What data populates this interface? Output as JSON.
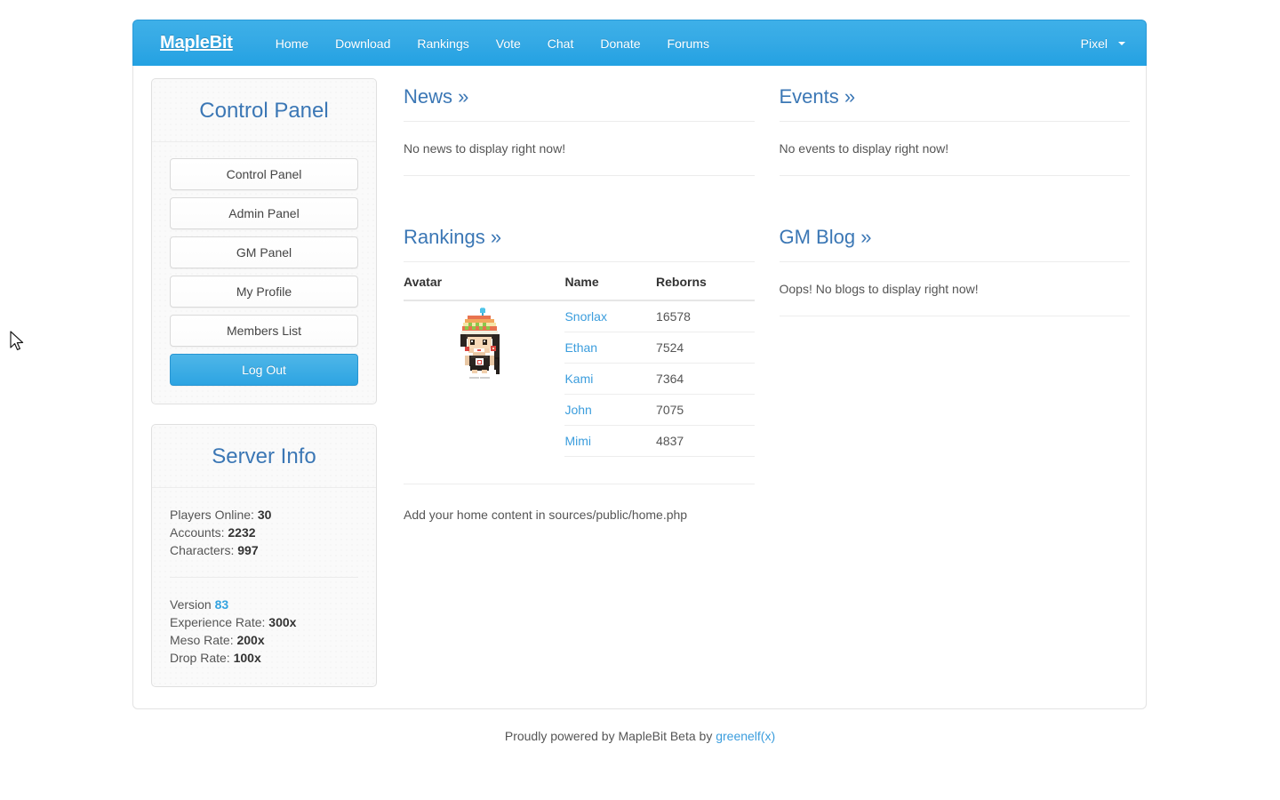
{
  "navbar": {
    "brand": "MapleBit",
    "links": [
      {
        "label": "Home"
      },
      {
        "label": "Download"
      },
      {
        "label": "Rankings"
      },
      {
        "label": "Vote"
      },
      {
        "label": "Chat"
      },
      {
        "label": "Donate"
      },
      {
        "label": "Forums"
      }
    ],
    "user": {
      "label": "Pixel",
      "caret": "chevron-down-icon"
    },
    "bg_color": "#34a9e5"
  },
  "sidebar": {
    "control_panel": {
      "title": "Control Panel",
      "buttons": [
        {
          "label": "Control Panel",
          "style": "default"
        },
        {
          "label": "Admin Panel",
          "style": "default"
        },
        {
          "label": "GM Panel",
          "style": "default"
        },
        {
          "label": "My Profile",
          "style": "default"
        },
        {
          "label": "Members List",
          "style": "default"
        },
        {
          "label": "Log Out",
          "style": "primary"
        }
      ]
    },
    "server_info": {
      "title": "Server Info",
      "stats": [
        {
          "label": "Players Online:",
          "value": "30"
        },
        {
          "label": "Accounts:",
          "value": "2232"
        },
        {
          "label": "Characters:",
          "value": "997"
        }
      ],
      "version_label": "Version",
      "version_value": "83",
      "rates": [
        {
          "label": "Experience Rate:",
          "value": "300x"
        },
        {
          "label": "Meso Rate:",
          "value": "200x"
        },
        {
          "label": "Drop Rate:",
          "value": "100x"
        }
      ]
    }
  },
  "main": {
    "news": {
      "title": "News »",
      "body": "No news to display right now!"
    },
    "events": {
      "title": "Events »",
      "body": "No events to display right now!"
    },
    "rankings": {
      "title": "Rankings »",
      "columns": [
        "Avatar",
        "Name",
        "Reborns"
      ],
      "avatar_alt": "character-avatar-sprite",
      "rows": [
        {
          "name": "Snorlax",
          "reborns": "16578"
        },
        {
          "name": "Ethan",
          "reborns": "7524"
        },
        {
          "name": "Kami",
          "reborns": "7364"
        },
        {
          "name": "John",
          "reborns": "7075"
        },
        {
          "name": "Mimi",
          "reborns": "4837"
        }
      ]
    },
    "gm_blog": {
      "title": "GM Blog »",
      "body": "Oops! No blogs to display right now!"
    },
    "home_note": "Add your home content in sources/public/home.php"
  },
  "footer": {
    "text": "Proudly powered by MapleBit Beta by",
    "link": "greenelf(x)"
  }
}
